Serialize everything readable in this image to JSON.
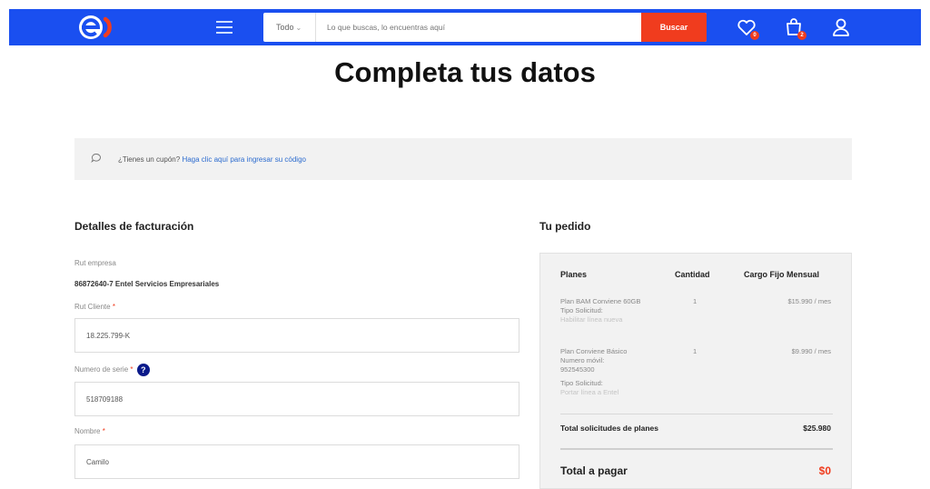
{
  "header": {
    "search": {
      "category": "Todo",
      "placeholder": "Lo que buscas, lo encuentras aquí",
      "button_label": "Buscar"
    },
    "wishlist_count": "0",
    "cart_count": "2",
    "colors": {
      "bar": "#1a4ff0",
      "accent": "#f03c1e"
    }
  },
  "page": {
    "title": "Completa tus datos"
  },
  "coupon": {
    "question": "¿Tienes un cupón?",
    "link": "Haga clic aquí para ingresar su código"
  },
  "billing": {
    "heading": "Detalles de facturación",
    "rut_empresa_label": "Rut empresa",
    "rut_empresa_value": "86872640-7 Entel Servicios Empresariales",
    "rut_cliente_label": "Rut Cliente",
    "rut_cliente_value": "18.225.799-K",
    "serie_label": "Numero de serie",
    "serie_value": "518709188",
    "nombre_label": "Nombre",
    "nombre_value": "Camilo",
    "required_mark": "*",
    "help_glyph": "?"
  },
  "order": {
    "heading": "Tu pedido",
    "columns": {
      "plans": "Planes",
      "qty": "Cantidad",
      "monthly": "Cargo Fijo Mensual"
    },
    "items": [
      {
        "name": "Plan BAM Conviene 60GB",
        "type_label": "Tipo Solicitud:",
        "type_value": "Habilitar línea nueva",
        "qty": "1",
        "price": "$15.990 / mes"
      },
      {
        "name": "Plan Conviene Básico",
        "mobile_label": "Numero móvil:",
        "mobile_value": "952545300",
        "type_label": "Tipo Solicitud:",
        "type_value": "Portar línea a Entel",
        "qty": "1",
        "price": "$9.990 / mes"
      }
    ],
    "total_label": "Total solicitudes de planes",
    "total_value": "$25.980",
    "pay_label": "Total a pagar",
    "pay_value": "$0"
  }
}
